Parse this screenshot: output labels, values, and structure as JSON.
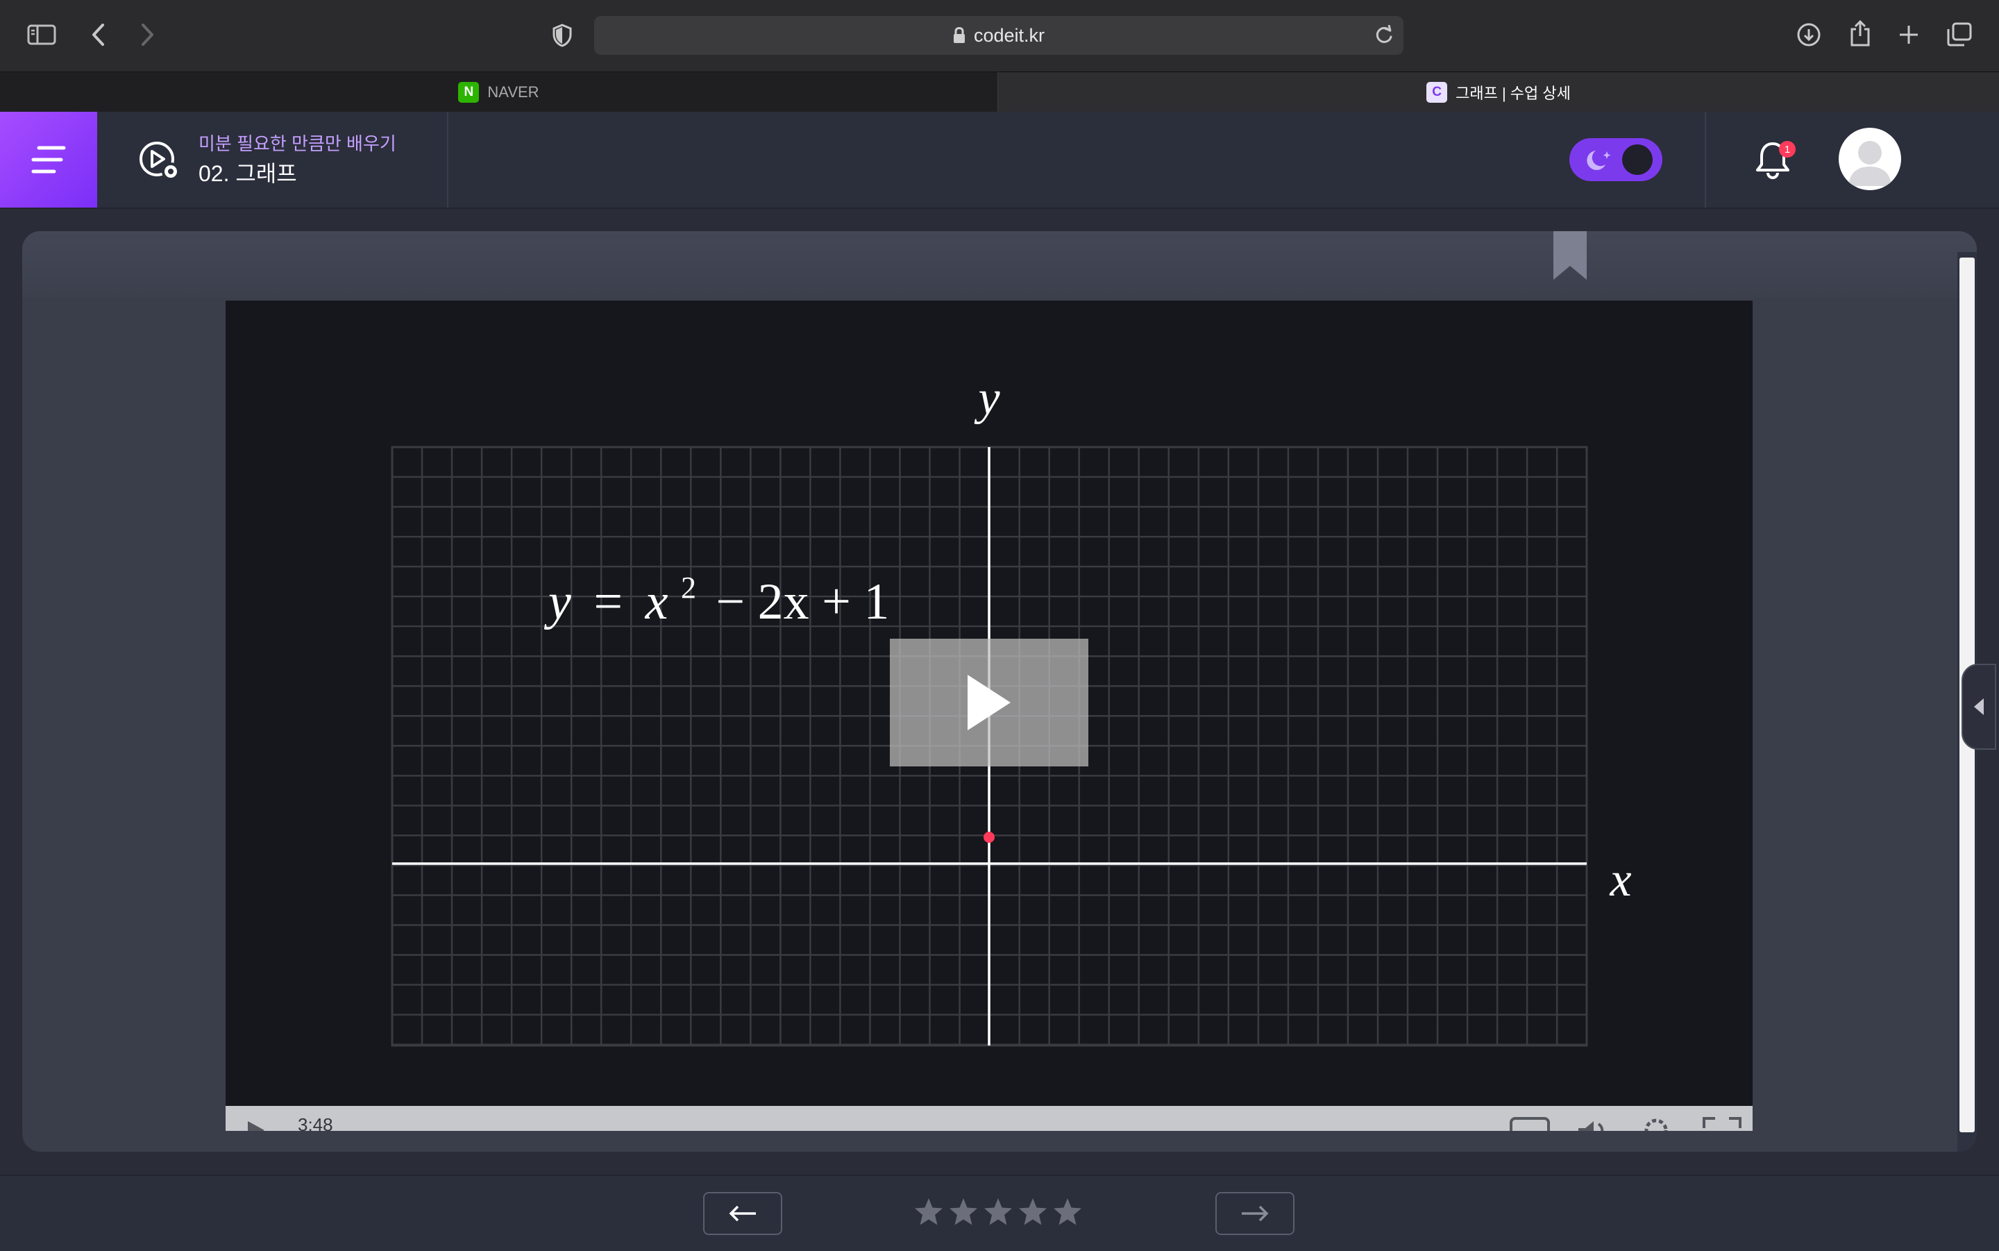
{
  "browser": {
    "url": "codeit.kr",
    "tabs": [
      {
        "label": "NAVER",
        "favicon_letter": "N",
        "favicon_color": "#2db400",
        "active": false
      },
      {
        "label": "그래프 | 수업 상세",
        "favicon_letter": "C",
        "favicon_color": "#8b5cf6",
        "active": true
      }
    ]
  },
  "header": {
    "course_name": "미분 필요한 만큼만 배우기",
    "lesson_title": "02. 그래프",
    "notification_count": "1",
    "accent_color": "#7c3aed"
  },
  "video": {
    "equation": {
      "y": "y",
      "eq": "=",
      "x": "x",
      "exp": "2",
      "rest": "− 2x + 1"
    },
    "axis_y_label": "y",
    "axis_x_label": "x",
    "time": "3:48"
  },
  "bottom": {
    "rating_stars": 5
  }
}
